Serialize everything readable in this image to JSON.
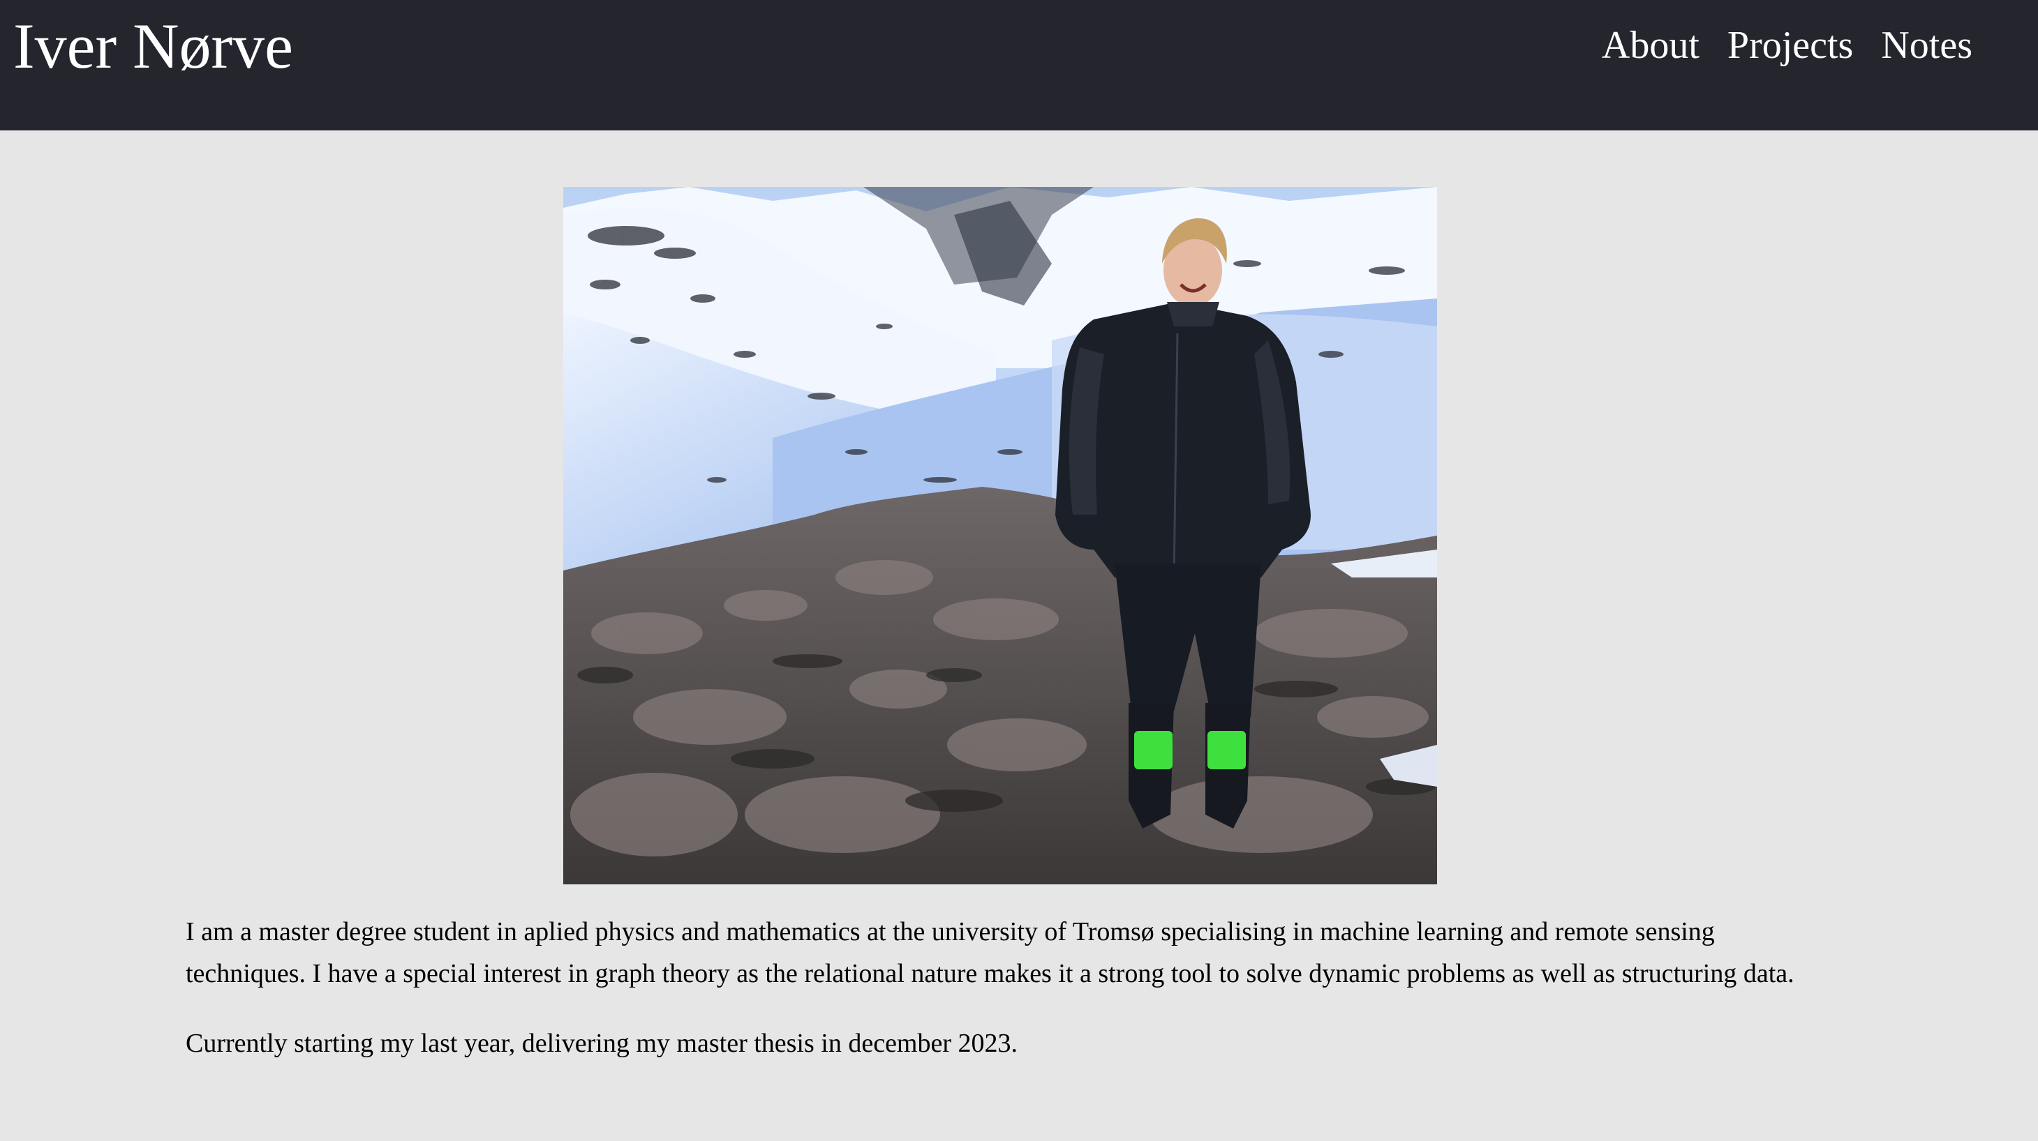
{
  "header": {
    "site_title": "Iver Nørve",
    "nav": [
      {
        "label": "About"
      },
      {
        "label": "Projects"
      },
      {
        "label": "Notes"
      }
    ],
    "background": "#24252d"
  },
  "main": {
    "photo_icon": "profile-photo",
    "paragraphs": [
      "I am a master degree student in aplied physics and mathematics at the university of Tromsø specialising in machine learning and remote sensing techniques. I have a special interest in graph theory as the relational nature makes it a strong tool to solve dynamic problems as well as structuring data.",
      "Currently starting my last year, delivering my master thesis in december 2023."
    ]
  },
  "colors": {
    "page_background": "#e6e6e6",
    "text": "#000000",
    "nav_text": "#ffffff",
    "boot_accent": "#3ee03e"
  }
}
